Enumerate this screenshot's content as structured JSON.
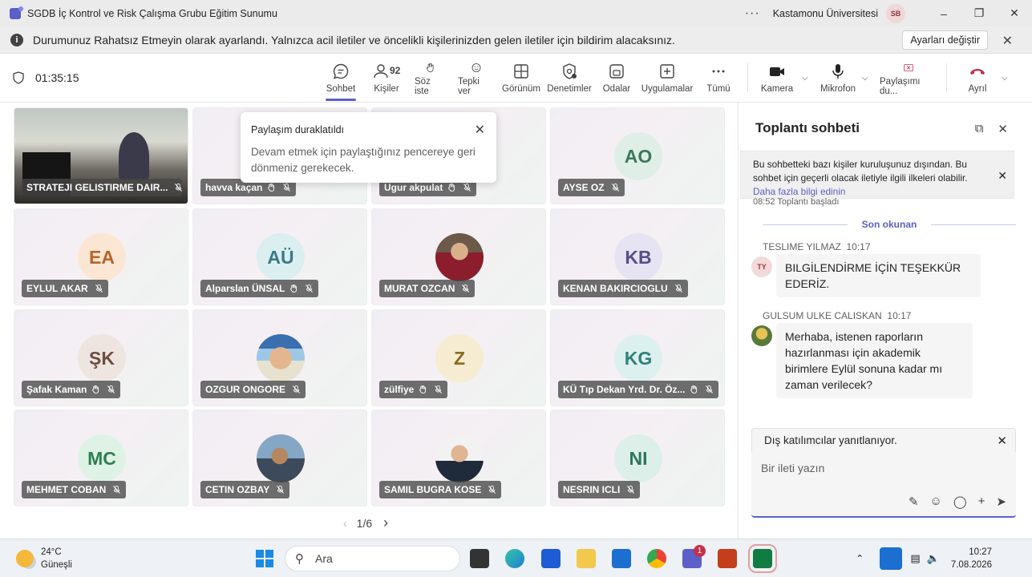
{
  "window": {
    "title": "SGDB İç Kontrol ve Risk Çalışma Grubu Eğitim Sunumu",
    "org": "Kastamonu Üniversitesi",
    "user_initials": "SB"
  },
  "banner": {
    "text": "Durumunuz Rahatsız Etmeyin olarak ayarlandı. Yalnızca acil iletiler ve öncelikli kişilerinizden gelen iletiler için bildirim alacaksınız.",
    "button": "Ayarları değiştir"
  },
  "toolbar": {
    "timer": "01:35:15",
    "items": [
      {
        "label": "Sohbet",
        "icon": "chat-icon"
      },
      {
        "label": "Kişiler",
        "icon": "people-icon",
        "badge": "92"
      },
      {
        "label": "Söz iste",
        "icon": "raise-hand-icon"
      },
      {
        "label": "Tepki ver",
        "icon": "emoji-icon"
      },
      {
        "label": "Görünüm",
        "icon": "view-icon"
      },
      {
        "label": "Denetimler",
        "icon": "controls-icon"
      },
      {
        "label": "Odalar",
        "icon": "rooms-icon"
      },
      {
        "label": "Uygulamalar",
        "icon": "apps-icon"
      },
      {
        "label": "Tümü",
        "icon": "more-icon"
      },
      {
        "label": "Kamera",
        "icon": "camera-icon"
      },
      {
        "label": "Mikrofon",
        "icon": "mic-icon"
      },
      {
        "label": "Paylaşımı du...",
        "icon": "stop-share-icon"
      },
      {
        "label": "Ayrıl",
        "icon": "leave-icon"
      }
    ]
  },
  "participants": [
    {
      "name": "STRATEJI GELISTIRME DAIR...",
      "type": "video"
    },
    {
      "name": "havva kaçan",
      "type": "blank",
      "hand": true
    },
    {
      "name": "Ugur akpulat",
      "type": "blank",
      "hand": true
    },
    {
      "name": "AYSE OZ",
      "initials": "AO",
      "bg": "#dfeee6",
      "fg": "#3b7a5a"
    },
    {
      "name": "EYLUL AKAR",
      "initials": "EA",
      "bg": "#fbe6d4",
      "fg": "#b5652a"
    },
    {
      "name": "Alparslan ÜNSAL",
      "initials": "AÜ",
      "bg": "#dbeef0",
      "fg": "#3a7a85",
      "hand": true
    },
    {
      "name": "MURAT OZCAN",
      "type": "photo",
      "photo": "p1"
    },
    {
      "name": "KENAN BAKIRCIOGLU",
      "initials": "KB",
      "bg": "#e6e3f2",
      "fg": "#5a4d8c"
    },
    {
      "name": "Şafak Kaman",
      "initials": "ŞK",
      "bg": "#eee5e0",
      "fg": "#6d4d3e",
      "hand": true
    },
    {
      "name": "OZGUR ONGORE",
      "type": "photo",
      "photo": "p2"
    },
    {
      "name": "zülfiye",
      "initials": "Z",
      "bg": "#f6ecd2",
      "fg": "#8a6a20",
      "hand": true
    },
    {
      "name": "KÜ Tıp Dekan Yrd. Dr. Öz...",
      "initials": "KG",
      "bg": "#dcf0ef",
      "fg": "#2f7f7a",
      "hand": true
    },
    {
      "name": "MEHMET COBAN",
      "initials": "MC",
      "bg": "#dff2e6",
      "fg": "#2f7f52"
    },
    {
      "name": "CETIN OZBAY",
      "type": "photo",
      "photo": "p3"
    },
    {
      "name": "SAMIL BUGRA KOSE",
      "type": "photo",
      "photo": "p4"
    },
    {
      "name": "NESRIN ICLI",
      "initials": "NI",
      "bg": "#dcefe8",
      "fg": "#2f7560"
    }
  ],
  "pager": "1/6",
  "toast": {
    "title": "Paylaşım duraklatıldı",
    "body": "Devam etmek için paylaştığınız pencereye geri dönmeniz gerekecek."
  },
  "chat": {
    "title": "Toplantı sohbeti",
    "notice_text": "Bu sohbetteki bazı kişiler kuruluşunuz dışından. Bu sohbet için geçerli olacak iletiyle ilgili ilkeleri olabilir.",
    "notice_link": "Daha fazla bilgi edinin",
    "cut_message": "08:52   Toplantı başladı",
    "divider": "Son okunan",
    "messages": [
      {
        "sender": "TESLIME YILMAZ",
        "time": "10:17",
        "initials": "TY",
        "text": "BILGİLENDİRME İÇİN TEŞEKKÜR EDERİZ."
      },
      {
        "sender": "GULSUM ULKE CALISKAN",
        "time": "10:17",
        "initials": "",
        "text": "Merhaba, istenen raporların hazırlanması için akademik birimlere Eylül sonuna kadar mı zaman verilecek?"
      }
    ],
    "reply_label": "Dış katılımcılar yanıtlanıyor.",
    "compose_placeholder": "Bir ileti yazın"
  },
  "taskbar": {
    "temp": "24°C",
    "weather": "Güneşli",
    "search": "Ara",
    "time": "10:27",
    "date": "7.08.2026",
    "teams_badge": "1"
  }
}
